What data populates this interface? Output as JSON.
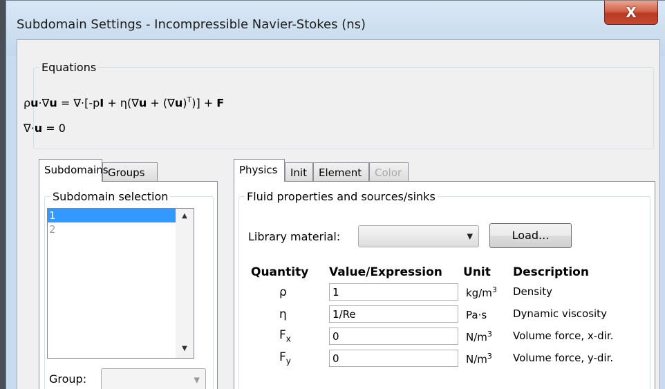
{
  "window": {
    "title": "Subdomain Settings - Incompressible Navier-Stokes (ns)",
    "close_label": "X"
  },
  "equations": {
    "legend": "Equations",
    "line1": {
      "a": "ρ",
      "b": "u",
      "c": "·∇",
      "d": "u",
      "e": " = ∇·[-p",
      "f": "I",
      "g": " + η(∇",
      "h": "u",
      "i": " + (∇",
      "j": "u",
      "k": ")",
      "l": "T",
      "m": ")] + ",
      "n": "F"
    },
    "line2": {
      "a": "∇·",
      "b": "u",
      "c": " = 0"
    }
  },
  "left_panel": {
    "tabs": [
      "Subdomains",
      "Groups"
    ],
    "selection_legend": "Subdomain selection",
    "items": [
      "1",
      "2"
    ],
    "group_label": "Group:"
  },
  "right_panel": {
    "tabs": [
      "Physics",
      "Init",
      "Element",
      "Color"
    ],
    "group_legend": "Fluid properties and sources/sinks",
    "library_label": "Library material:",
    "library_value": "",
    "load_label": "Load...",
    "headers": {
      "quantity": "Quantity",
      "value": "Value/Expression",
      "unit": "Unit",
      "description": "Description"
    },
    "rows": [
      {
        "symbol": "ρ",
        "sub": "",
        "value": "1",
        "unit": "kg/m",
        "unit_sup": "3",
        "description": "Density"
      },
      {
        "symbol": "η",
        "sub": "",
        "value": "1/Re",
        "unit": "Pa·s",
        "unit_sup": "",
        "description": "Dynamic viscosity"
      },
      {
        "symbol": "F",
        "sub": "x",
        "value": "0",
        "unit": "N/m",
        "unit_sup": "3",
        "description": "Volume force, x-dir."
      },
      {
        "symbol": "F",
        "sub": "y",
        "value": "0",
        "unit": "N/m",
        "unit_sup": "3",
        "description": "Volume force, y-dir."
      }
    ]
  }
}
